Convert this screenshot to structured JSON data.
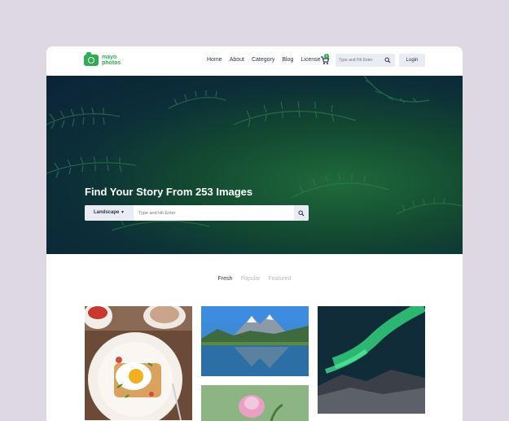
{
  "brand": {
    "line1": "mayo",
    "line2": "photos",
    "color": "#2dae54"
  },
  "nav": {
    "items": [
      "Home",
      "About",
      "Category",
      "Blog",
      "License"
    ]
  },
  "cart": {
    "icon": "cart-icon",
    "badge": "0"
  },
  "header_search": {
    "placeholder": "Type and Hit Enter",
    "icon": "search-icon"
  },
  "login": {
    "label": "Login"
  },
  "hero": {
    "title": "Find Your Story From 253 Images",
    "category": "Landscape",
    "placeholder": "Type and Hit Enter"
  },
  "tabs": [
    "Fresh",
    "Popular",
    "Featured"
  ],
  "active_tab": "Fresh",
  "gallery": [
    {
      "subject": "breakfast plate with fried egg"
    },
    {
      "subject": "mountain lake reflection"
    },
    {
      "subject": "aurora borealis over hills"
    },
    {
      "subject": "pink flower"
    }
  ],
  "colors": {
    "background": "#ddd8e2",
    "text": "#2a3352",
    "muted": "#b5b9c6",
    "accent": "#2dae54"
  }
}
